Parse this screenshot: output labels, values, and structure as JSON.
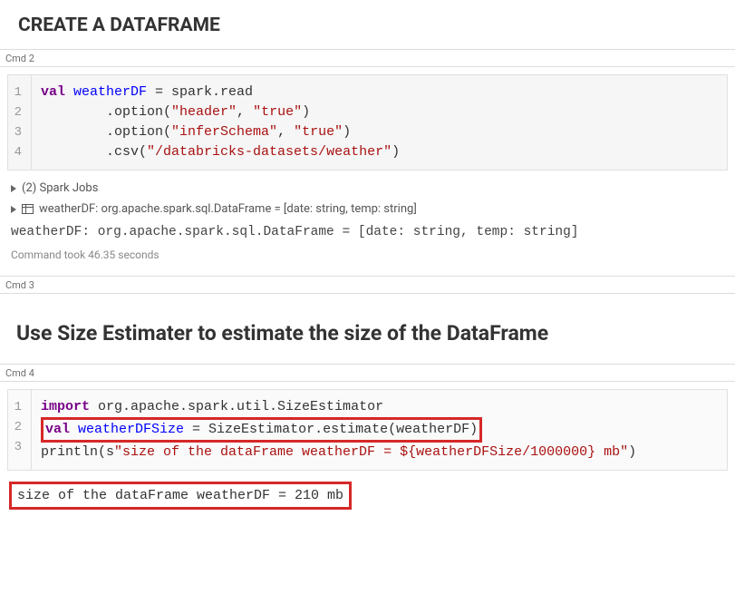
{
  "heading1": "CREATE A DATAFRAME",
  "cmd2": "Cmd 2",
  "code1": {
    "ln1": "1",
    "ln2": "2",
    "ln3": "3",
    "ln4": "4",
    "l1_kw": "val",
    "l1_var": " weatherDF",
    "l1_rest": " = spark.read",
    "l2_a": "        .option(",
    "l2_s1": "\"header\"",
    "l2_m": ", ",
    "l2_s2": "\"true\"",
    "l2_e": ")",
    "l3_a": "        .option(",
    "l3_s1": "\"inferSchema\"",
    "l3_m": ", ",
    "l3_s2": "\"true\"",
    "l3_e": ")",
    "l4_a": "        .csv(",
    "l4_s1": "\"/databricks-datasets/weather\"",
    "l4_e": ")"
  },
  "jobs": "(2) Spark Jobs",
  "schema": "weatherDF:  org.apache.spark.sql.DataFrame = [date: string, temp: string]",
  "mono_out": "weatherDF: org.apache.spark.sql.DataFrame = [date: string, temp: string]",
  "timing": "Command took 46.35 seconds",
  "cmd3": "Cmd 3",
  "heading2": "Use Size Estimater to estimate the size of the DataFrame",
  "cmd4": "Cmd 4",
  "code2": {
    "ln1": "1",
    "ln2": "2",
    "ln3": "3",
    "l1_kw": "import",
    "l1_rest": " org.apache.spark.util.SizeEstimator",
    "l2_kw": "val",
    "l2_var": " weatherDFSize",
    "l2_rest": " = SizeEstimator.estimate(weatherDF)",
    "l3_a": "println(s",
    "l3_s": "\"size of the dataFrame weatherDF = ${weatherDFSize/1000000} mb\"",
    "l3_e": ")"
  },
  "result": "size of the dataFrame weatherDF = 210 mb"
}
